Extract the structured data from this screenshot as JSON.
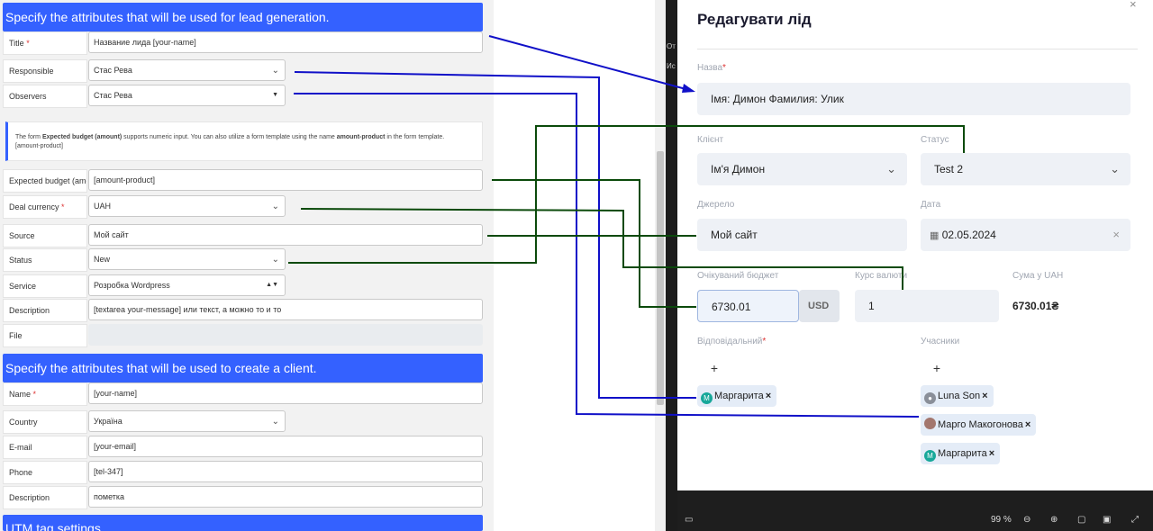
{
  "lead_section": {
    "heading": "Specify the attributes that will be used for lead generation.",
    "rows": {
      "title": {
        "label": "Title",
        "value": "Название лида [your-name]"
      },
      "responsible": {
        "label": "Responsible",
        "value": "Стас Рева"
      },
      "observers": {
        "label": "Observers",
        "value": "Стас Рева"
      },
      "expected_budget": {
        "label": "Expected budget (amount)",
        "value": "[amount-product]"
      },
      "deal_currency": {
        "label": "Deal currency",
        "value": "UAH"
      },
      "source": {
        "label": "Source",
        "value": "Мой сайт"
      },
      "status": {
        "label": "Status",
        "value": "New"
      },
      "service": {
        "label": "Service",
        "value": "Розробка Wordpress"
      },
      "description": {
        "label": "Description",
        "value": "[textarea your-message] или текст, а можно то и то"
      },
      "file": {
        "label": "File",
        "value": ""
      }
    },
    "info": {
      "t1": "The form ",
      "b1": "Expected budget (amount)",
      "t2": " supports numeric input. You can also utilize a form template using the name ",
      "b2": "amount-product",
      "t3": " in the form template.",
      "t4": "[amount-product]"
    },
    "required_mark": "*"
  },
  "client_section": {
    "heading": "Specify the attributes that will be used to create a client.",
    "rows": {
      "name": {
        "label": "Name",
        "value": "[your-name]"
      },
      "country": {
        "label": "Country",
        "value": "Україна"
      },
      "email": {
        "label": "E-mail",
        "value": "[your-email]"
      },
      "phone": {
        "label": "Phone",
        "value": "[tel-347]"
      },
      "description": {
        "label": "Description",
        "value": "пометка"
      }
    }
  },
  "utm_section": {
    "heading": "UTM tag settings"
  },
  "dark_strip": {
    "t1": "От",
    "t2": "Ис"
  },
  "modal": {
    "title": "Редагувати лід",
    "close_glyph": "×",
    "name_label": "Назва",
    "name_value": "Імя: Димон Фамилия: Улик",
    "client_label": "Клієнт",
    "client_value": "Ім'я Димон",
    "status_label": "Статус",
    "status_value": "Test 2",
    "source_label": "Джерело",
    "source_value": "Мой сайт",
    "date_label": "Дата",
    "date_value": "02.05.2024",
    "budget_label": "Очікуваний бюджет",
    "budget_value": "6730.01",
    "budget_currency": "USD",
    "rate_label": "Курс валюти",
    "rate_value": "1",
    "sum_label": "Сума у UAH",
    "sum_value": "6730.01₴",
    "responsible_label": "Відповідальний",
    "participants_label": "Учасники",
    "responsible_chips": [
      {
        "initial": "M",
        "name": "Маргарита"
      }
    ],
    "participant_chips": [
      {
        "initial": "",
        "name": "Luna Son"
      },
      {
        "initial": "",
        "name": "Марго Макогонова"
      },
      {
        "initial": "M",
        "name": "Маргарита"
      }
    ],
    "chip_remove": "×",
    "add_glyph": "+"
  },
  "bottom_bar": {
    "zoom": "99 %"
  },
  "colors": {
    "accent": "#3461ff",
    "blue_line": "#1010c8",
    "green_line": "#0b4a0b"
  }
}
